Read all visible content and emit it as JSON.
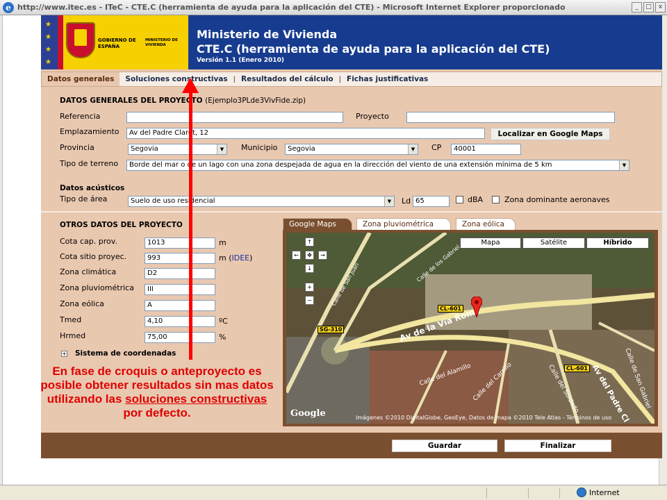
{
  "window": {
    "title": "http://www.itec.es - ITeC - CTE.C (herramienta de ayuda para la aplicación del CTE) - Microsoft Internet Explorer proporcionado",
    "buttons": [
      "_",
      "□",
      "x"
    ]
  },
  "header": {
    "gobierno": "GOBIERNO DE ESPAÑA",
    "ministerio_small": "MINISTERIO DE VIVIENDA",
    "title1": "Ministerio de Vivienda",
    "title2": "CTE.C (herramienta de ayuda para la aplicación del CTE)",
    "version": "Versión 1.1 (Enero 2010)"
  },
  "nav": {
    "items": [
      "Datos generales",
      "Soluciones constructivas",
      "Resultados del cálculo",
      "Fichas justificativas"
    ],
    "separator": "|"
  },
  "datos_generales": {
    "title": "DATOS GENERALES DEL PROYECTO",
    "filename": "(Ejemplo3PLde3VivFide.zip)",
    "referencia_label": "Referencia",
    "referencia_value": "",
    "proyecto_label": "Proyecto",
    "proyecto_value": "",
    "emplazamiento_label": "Emplazamiento",
    "emplazamiento_value": "Av del Padre Claret, 12",
    "localizar_button": "Localizar en Google Maps",
    "provincia_label": "Provincia",
    "provincia_value": "Segovia",
    "municipio_label": "Municipio",
    "municipio_value": "Segovia",
    "cp_label": "CP",
    "cp_value": "40001",
    "terreno_label": "Tipo de terreno",
    "terreno_value": "Borde del mar o de un lago con una zona despejada de agua en la dirección del viento de una extensión mínima de 5 km"
  },
  "acusticos": {
    "title": "Datos acústicos",
    "area_label": "Tipo de área",
    "area_value": "Suelo de uso residencial",
    "ld_label": "Ld",
    "ld_value": "65",
    "dba_label": "dBA",
    "aeronaves_label": "Zona dominante aeronaves"
  },
  "otros": {
    "title": "OTROS DATOS DEL PROYECTO",
    "rows": [
      {
        "label": "Cota cap. prov.",
        "value": "1013",
        "unit": "m"
      },
      {
        "label": "Cota sitio proyec.",
        "value": "993",
        "unit": "m ("
      },
      {
        "label": "Zona climática",
        "value": "D2",
        "unit": ""
      },
      {
        "label": "Zona pluviométrica",
        "value": "III",
        "unit": ""
      },
      {
        "label": "Zona eólica",
        "value": "A",
        "unit": ""
      },
      {
        "label": "Tmed",
        "value": "4,10",
        "unit": "ºC"
      },
      {
        "label": "Hrmed",
        "value": "75,00",
        "unit": "%"
      }
    ],
    "idee_link": "IDEE",
    "idee_close": ")",
    "coordenadas_label": "Sistema de coordenadas"
  },
  "map": {
    "tabs": [
      "Google Maps",
      "Zona pluviométrica",
      "Zona eólica"
    ],
    "type_buttons": [
      "Mapa",
      "Satélite",
      "Híbrido"
    ],
    "pan": {
      "up": "↑",
      "left": "←",
      "center": "✥",
      "right": "→",
      "down": "↓",
      "zoom_in": "+",
      "zoom_out": "−"
    },
    "labels": [
      "Calle de los Gabriel",
      "Calle de San Juan",
      "Av de la Vía Roma",
      "CL-601",
      "SG-310",
      "Calle del Alamillo",
      "Calle del Carrillo",
      "Calle del Soldado",
      "CL-601",
      "Av del Padre Cl",
      "Calle de San Gabriel"
    ],
    "copyright": "Imágenes ©2010 DigitalGlobe, GeoEye, Datos de mapa ©2010 Tele Atlas - Términos de uso",
    "google": "Google"
  },
  "footer": {
    "guardar": "Guardar",
    "finalizar": "Finalizar"
  },
  "annotation": {
    "part1": "En fase de croquis o anteproyecto es posible obtener resultados sin mas datos utilizando las",
    "link": "soluciones constructivas",
    "part2": "por defecto."
  },
  "statusbar": {
    "zone": "Internet"
  },
  "colors": {
    "header_blue": "#173c8f",
    "page_bg": "#e9c8b0",
    "footer_brown": "#7a4f2f",
    "annotation_red": "#ff0000"
  }
}
